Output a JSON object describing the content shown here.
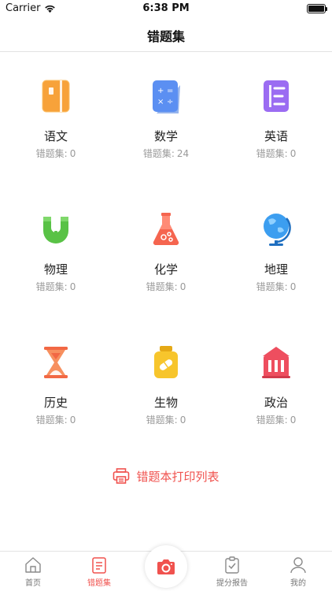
{
  "status_bar": {
    "carrier": "Carrier",
    "time": "6:38 PM"
  },
  "nav": {
    "title": "错题集"
  },
  "subjects": [
    {
      "name": "语文",
      "count_label": "错题集:",
      "count": "0",
      "icon": "chinese-book-icon",
      "color": "#f7a23a"
    },
    {
      "name": "数学",
      "count_label": "错题集:",
      "count": "24",
      "icon": "math-calculator-icon",
      "color": "#5b8ff2"
    },
    {
      "name": "英语",
      "count_label": "错题集:",
      "count": "0",
      "icon": "english-book-icon",
      "color": "#9b6cf2"
    },
    {
      "name": "物理",
      "count_label": "错题集:",
      "count": "0",
      "icon": "physics-magnet-icon",
      "color": "#59c246"
    },
    {
      "name": "化学",
      "count_label": "错题集:",
      "count": "0",
      "icon": "chemistry-flask-icon",
      "color": "#f5654f"
    },
    {
      "name": "地理",
      "count_label": "错题集:",
      "count": "0",
      "icon": "geography-globe-icon",
      "color": "#3c9ef0"
    },
    {
      "name": "历史",
      "count_label": "错题集:",
      "count": "0",
      "icon": "history-hourglass-icon",
      "color": "#f26844"
    },
    {
      "name": "生物",
      "count_label": "错题集:",
      "count": "0",
      "icon": "biology-pill-bottle-icon",
      "color": "#f7c52c"
    },
    {
      "name": "政治",
      "count_label": "错题集:",
      "count": "0",
      "icon": "politics-building-icon",
      "color": "#ee4e5f"
    }
  ],
  "print_link": {
    "label": "错题本打印列表",
    "icon": "printer-icon"
  },
  "tab_bar": {
    "tabs": [
      {
        "label": "首页",
        "icon": "home-icon",
        "active": false
      },
      {
        "label": "错题集",
        "icon": "notebook-icon",
        "active": true
      },
      {
        "label": "",
        "icon": "camera-icon",
        "active": false
      },
      {
        "label": "提分报告",
        "icon": "report-icon",
        "active": false
      },
      {
        "label": "我的",
        "icon": "profile-icon",
        "active": false
      }
    ]
  },
  "colors": {
    "accent": "#f0524e",
    "muted": "#9a9a9a"
  }
}
